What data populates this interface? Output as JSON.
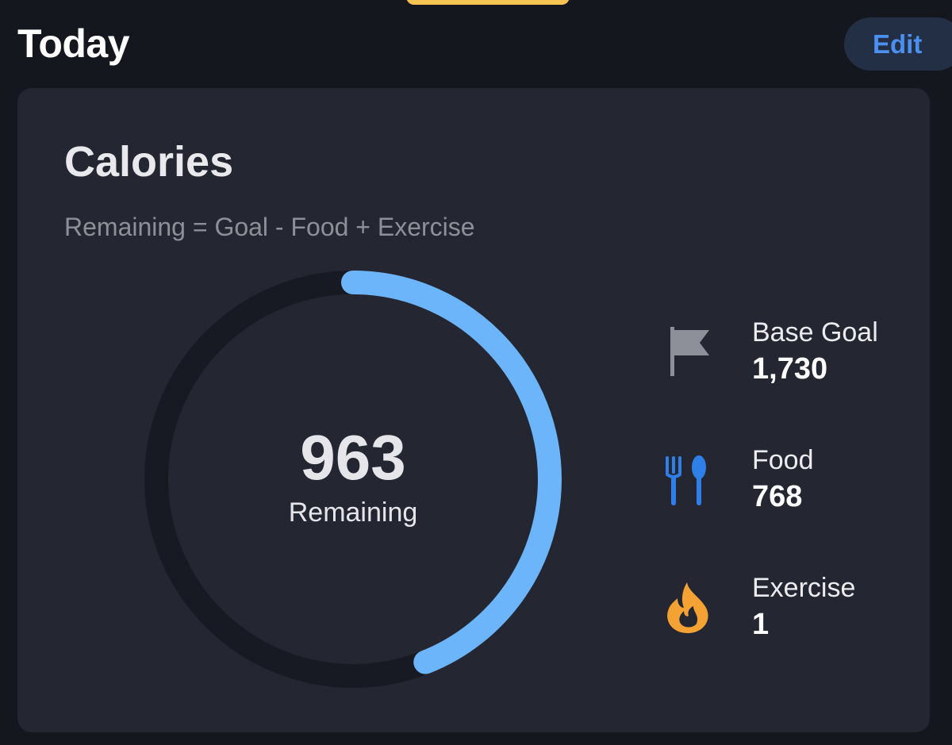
{
  "header": {
    "title": "Today",
    "edit_label": "Edit"
  },
  "calories": {
    "title": "Calories",
    "subtitle": "Remaining = Goal - Food + Exercise",
    "remaining_value": "963",
    "remaining_label": "Remaining",
    "progress_fraction": 0.44
  },
  "stats": [
    {
      "label": "Base Goal",
      "value": "1,730",
      "icon": "flag-icon"
    },
    {
      "label": "Food",
      "value": "768",
      "icon": "fork-spoon-icon"
    },
    {
      "label": "Exercise",
      "value": "1",
      "icon": "flame-icon"
    }
  ],
  "colors": {
    "background": "#15171f",
    "card": "#242732",
    "ring_track": "#181a23",
    "ring_progress": "#6db5fb",
    "edit_text": "#4b8ff0",
    "food_icon": "#2f7fe8",
    "exercise_icon": "#f4a233",
    "goal_icon": "#8e9099"
  }
}
